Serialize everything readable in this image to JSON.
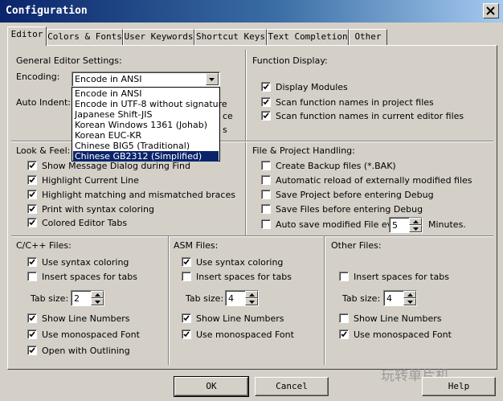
{
  "window": {
    "title": "Configuration"
  },
  "tabs": [
    "Editor",
    "Colors & Fonts",
    "User Keywords",
    "Shortcut Keys",
    "Text Completion",
    "Other"
  ],
  "general": {
    "title": "General Editor Settings:",
    "encoding_label": "Encoding:",
    "encoding_value": "Encode in ANSI",
    "auto_indent_label": "Auto Indent:",
    "hidden_fragment_1": "ce",
    "hidden_fragment_2": "s",
    "encoding_options": [
      "Encode in ANSI",
      "Encode in UTF-8 without signature",
      "Japanese Shift-JIS",
      "Korean Windows 1361 (Johab)",
      "Korean EUC-KR",
      "Chinese BIG5 (Traditional)",
      "Chinese GB2312 (Simplified)"
    ],
    "selected_option": "Chinese GB2312 (Simplified)"
  },
  "function_display": {
    "title": "Function Display:",
    "items": [
      {
        "label": "Display Modules",
        "checked": true
      },
      {
        "label": "Scan function names in project files",
        "checked": true
      },
      {
        "label": "Scan function names in current editor files",
        "checked": true
      }
    ]
  },
  "look_feel": {
    "title": "Look & Feel:",
    "items": [
      {
        "label": "Show Message Dialog during Find",
        "checked": true
      },
      {
        "label": "Highlight Current Line",
        "checked": true
      },
      {
        "label": "Highlight matching and mismatched braces",
        "checked": true
      },
      {
        "label": "Print with syntax coloring",
        "checked": true
      },
      {
        "label": "Colored Editor Tabs",
        "checked": true
      }
    ]
  },
  "file_project": {
    "title": "File & Project Handling:",
    "items": [
      {
        "label": "Create Backup files (*.BAK)",
        "checked": false
      },
      {
        "label": "Automatic reload of externally modified files",
        "checked": false
      },
      {
        "label": "Save Project before entering Debug",
        "checked": false
      },
      {
        "label": "Save Files before entering Debug",
        "checked": false
      },
      {
        "label": "Auto save modified File every",
        "checked": false
      }
    ],
    "autosave_value": "5",
    "minutes_label": "Minutes."
  },
  "cpp_files": {
    "title": "C/C++ Files:",
    "items": [
      {
        "label": "Use syntax coloring",
        "checked": true
      },
      {
        "label": "Insert spaces for tabs",
        "checked": false
      }
    ],
    "tab_size_label": "Tab size:",
    "tab_size": "2",
    "items2": [
      {
        "label": "Show Line Numbers",
        "checked": true
      },
      {
        "label": "Use monospaced Font",
        "checked": true
      },
      {
        "label": "Open with Outlining",
        "checked": true
      }
    ]
  },
  "asm_files": {
    "title": "ASM Files:",
    "items": [
      {
        "label": "Use syntax coloring",
        "checked": true
      },
      {
        "label": "Insert spaces for tabs",
        "checked": false
      }
    ],
    "tab_size_label": "Tab size:",
    "tab_size": "4",
    "items2": [
      {
        "label": "Show Line Numbers",
        "checked": true
      },
      {
        "label": "Use monospaced Font",
        "checked": true
      }
    ]
  },
  "other_files": {
    "title": "Other Files:",
    "items": [
      {
        "label": "Insert spaces for tabs",
        "checked": false
      }
    ],
    "tab_size_label": "Tab size:",
    "tab_size": "4",
    "items2": [
      {
        "label": "Show Line Numbers",
        "checked": false
      },
      {
        "label": "Use monospaced Font",
        "checked": true
      }
    ]
  },
  "buttons": {
    "ok": "OK",
    "cancel": "Cancel",
    "help": "Help"
  },
  "watermark": "玩转单片机",
  "colors": {
    "title_start": "#0a246a",
    "title_end": "#a6caf0",
    "face": "#d4d0c8",
    "selection": "#0a246a"
  }
}
